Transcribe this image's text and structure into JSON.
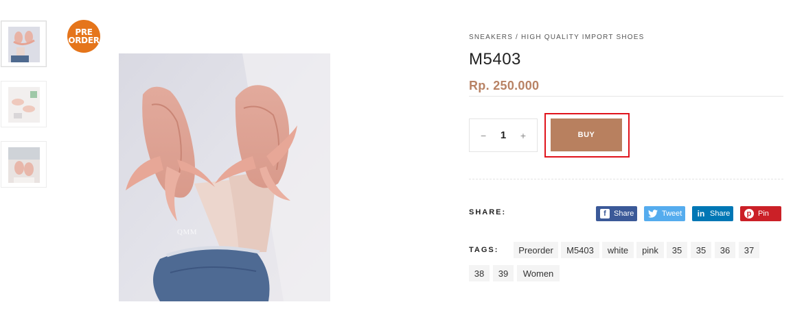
{
  "gallery": {
    "badge_line1": "PRE",
    "badge_line2": "ORDER",
    "watermark": "QMM"
  },
  "product": {
    "breadcrumb": "SNEAKERS / HIGH QUALITY IMPORT SHOES",
    "title": "M5403",
    "price": "Rp. 250.000"
  },
  "purchase": {
    "minus_label": "−",
    "quantity": "1",
    "plus_label": "+",
    "buy_label": "BUY"
  },
  "share": {
    "label": "SHARE:",
    "buttons": [
      {
        "label": "Share",
        "icon": "facebook-icon"
      },
      {
        "label": "Tweet",
        "icon": "twitter-icon"
      },
      {
        "label": "Share",
        "icon": "linkedin-icon"
      },
      {
        "label": "Pin",
        "icon": "pinterest-icon"
      }
    ]
  },
  "tags": {
    "label": "TAGS:",
    "items": [
      "Preorder",
      "M5403",
      "white",
      "pink",
      "35",
      "35",
      "36",
      "37",
      "38",
      "39",
      "Women"
    ]
  },
  "colors": {
    "price": "#b88264",
    "buy_button": "#b8805f",
    "highlight_outline": "#e0121b",
    "badge": "#e5751b"
  }
}
